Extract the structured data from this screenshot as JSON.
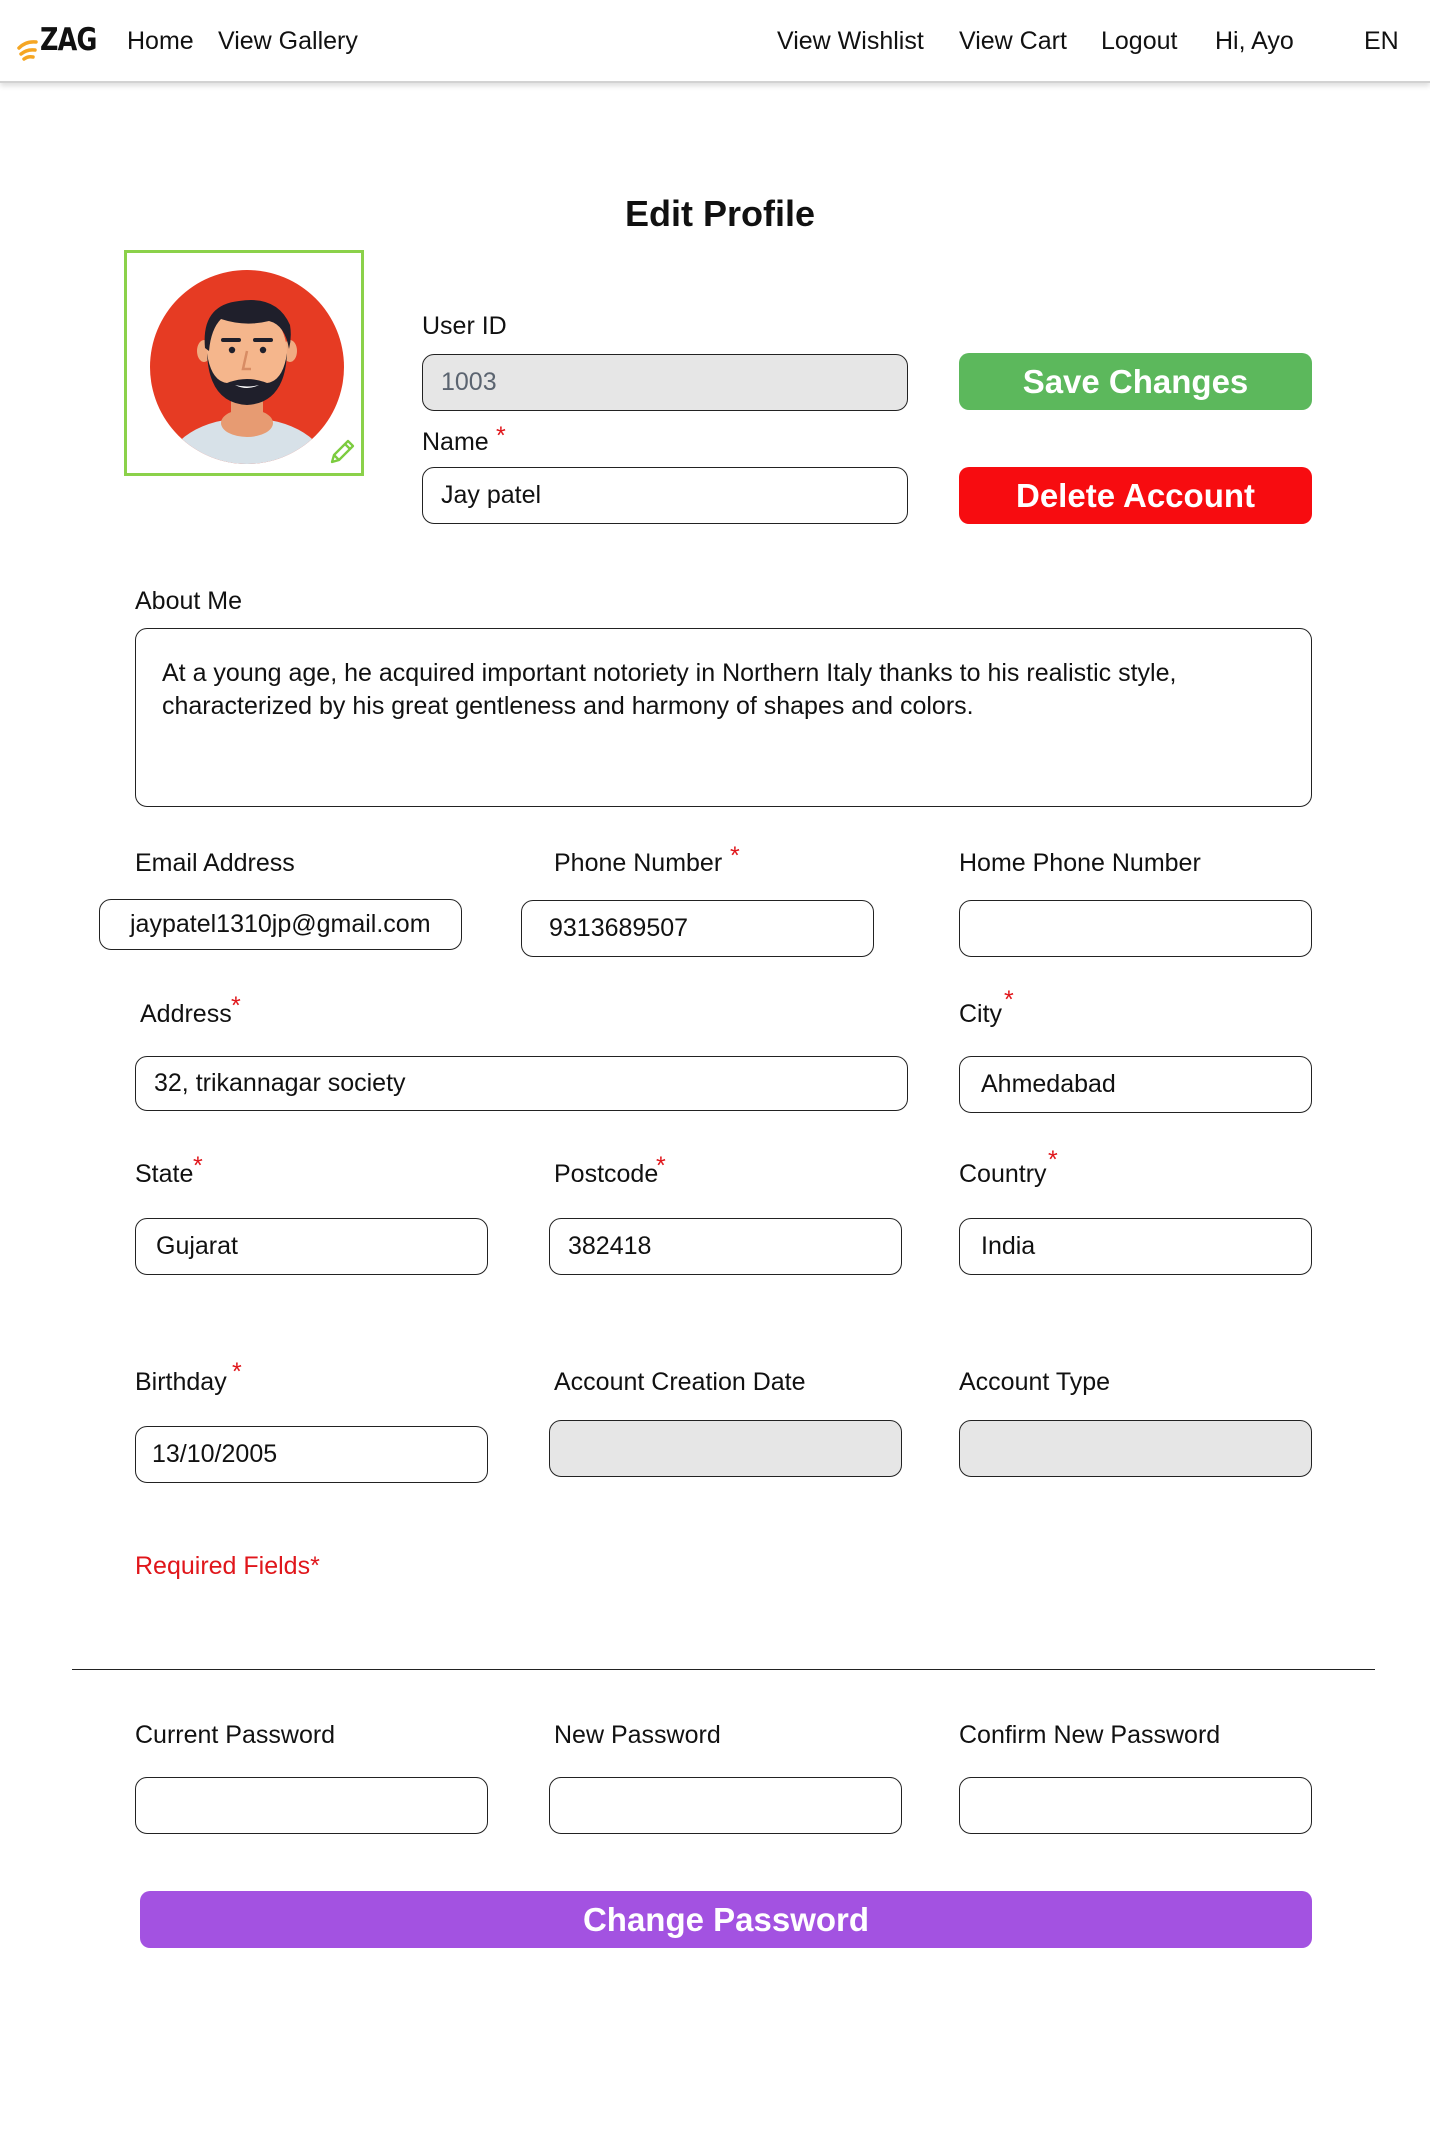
{
  "nav": {
    "logo_text": "ZAG",
    "links": [
      "Home",
      "View Gallery",
      "View Wishlist",
      "View Cart",
      "Logout",
      "Hi, Ayo",
      "EN"
    ]
  },
  "page": {
    "title": "Edit Profile"
  },
  "profile": {
    "user_id_label": "User ID",
    "user_id_value": "1003",
    "name_label": "Name",
    "name_value": "Jay patel",
    "save_label": "Save Changes",
    "delete_label": "Delete Account",
    "about_label": "About Me",
    "about_value": "At a young age, he acquired important notoriety in Northern Italy thanks to his realistic style, characterized by his great gentleness and harmony of shapes and colors.",
    "email_label": "Email Address",
    "email_value": "jaypatel1310jp@gmail.com",
    "phone_label": "Phone Number",
    "phone_value": "9313689507",
    "home_phone_label": "Home Phone Number",
    "home_phone_value": "",
    "address_label": "Address",
    "address_value": "32, trikannagar society",
    "city_label": "City",
    "city_value": "Ahmedabad",
    "state_label": "State",
    "state_value": "Gujarat",
    "postcode_label": "Postcode",
    "postcode_value": "382418",
    "country_label": "Country",
    "country_value": "India",
    "birthday_label": "Birthday",
    "birthday_value": "13/10/2005",
    "creation_label": "Account Creation Date",
    "creation_value": "",
    "type_label": "Account Type",
    "type_value": "",
    "required_note": "Required Fields*",
    "required_mark": "*"
  },
  "password": {
    "current_label": "Current Password",
    "new_label": "New Password",
    "confirm_label": "Confirm New Password",
    "change_label": "Change Password"
  },
  "colors": {
    "save": "#5cb85c",
    "delete": "#f70c10",
    "change": "#a352e1",
    "required": "#e0161b",
    "avatar_border": "#8bd14a"
  }
}
